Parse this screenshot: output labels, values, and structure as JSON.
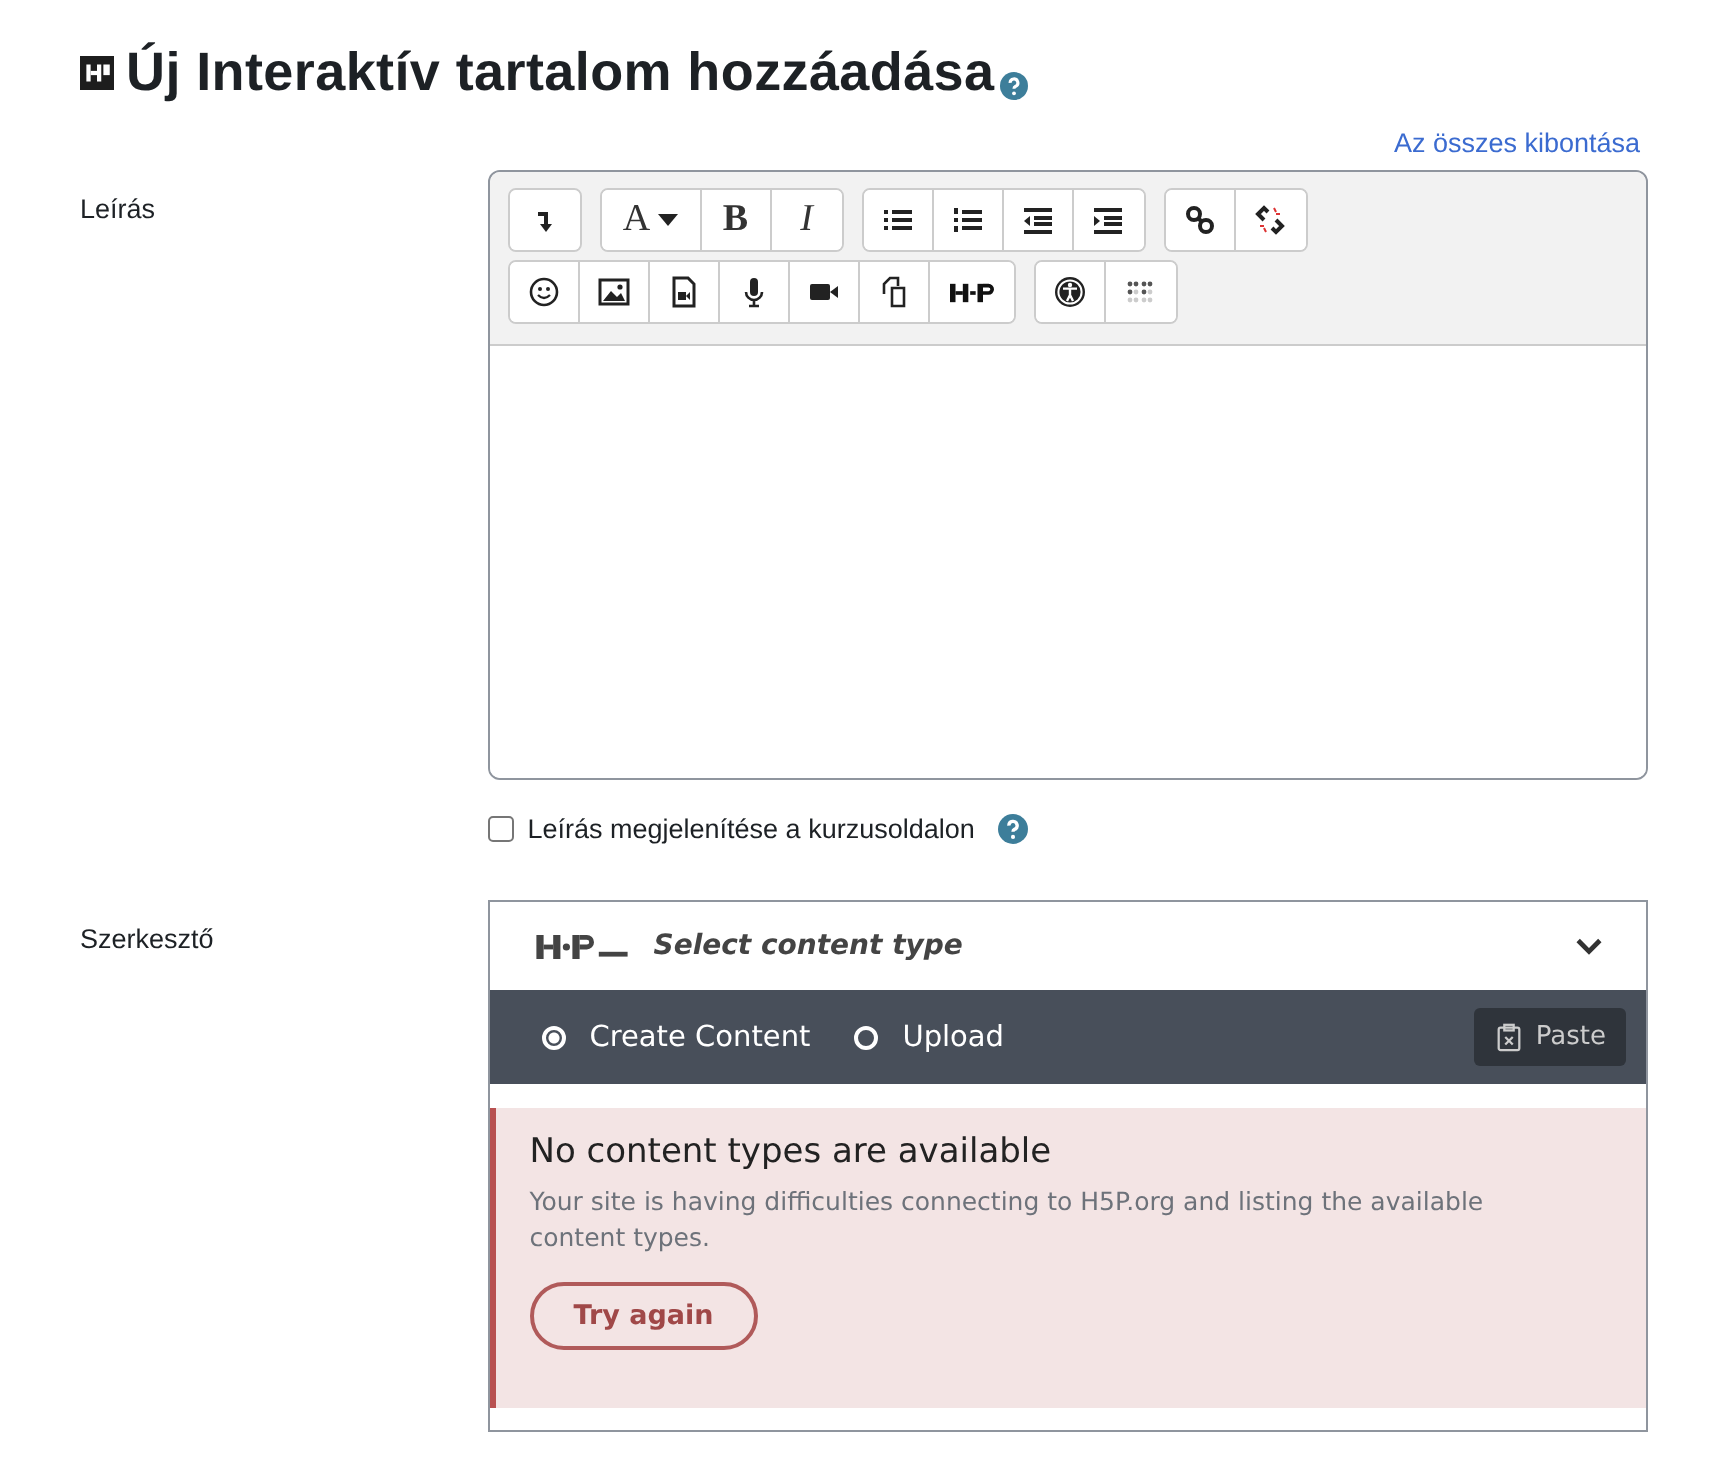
{
  "page_title": "Új Interaktív tartalom hozzáadása",
  "expand_all_link": "Az összes kibontása",
  "description": {
    "label": "Leírás",
    "toolbar": {
      "font_label": "A",
      "bold_label": "B",
      "italic_label": "I"
    },
    "show_on_course": {
      "label": "Leírás megjelenítése a kurzusoldalon",
      "checked": false
    }
  },
  "editor": {
    "label": "Szerkesztő",
    "hub_title": "Select content type",
    "expanded": false,
    "tabs": [
      {
        "label": "Create Content",
        "selected": true
      },
      {
        "label": "Upload",
        "selected": false
      }
    ],
    "paste_button": "Paste",
    "message": {
      "title": "No content types are available",
      "text": "Your site is having difficulties connecting to H5P.org and listing the available content types.",
      "button": "Try again"
    }
  }
}
